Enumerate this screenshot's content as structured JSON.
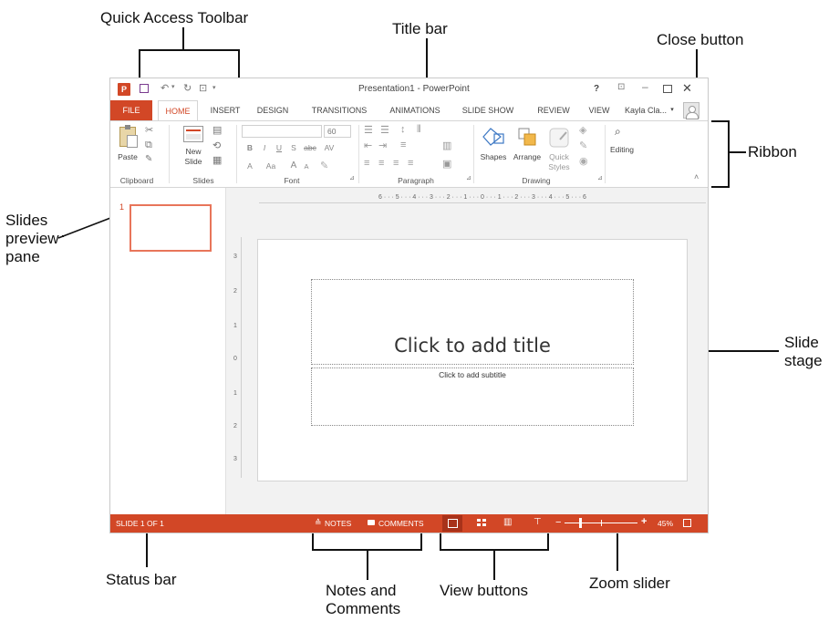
{
  "callouts": {
    "quick_access_toolbar": "Quick Access Toolbar",
    "title_bar": "Title bar",
    "close_button": "Close button",
    "ribbon": "Ribbon",
    "slides_preview_pane_1": "Slides",
    "slides_preview_pane_2": "preview",
    "slides_preview_pane_3": "pane",
    "slide_stage_1": "Slide",
    "slide_stage_2": "stage",
    "status_bar": "Status bar",
    "notes_comments_1": "Notes and",
    "notes_comments_2": "Comments",
    "view_buttons": "View buttons",
    "zoom_slider": "Zoom slider"
  },
  "window": {
    "title": "Presentation1 - PowerPoint",
    "help": "?",
    "user": "Kayla Cla...",
    "user_caret": "▾"
  },
  "tabs": [
    "FILE",
    "HOME",
    "INSERT",
    "DESIGN",
    "TRANSITIONS",
    "ANIMATIONS",
    "SLIDE SHOW",
    "REVIEW",
    "VIEW"
  ],
  "ribbon": {
    "paste": "Paste",
    "new_slide_1": "New",
    "new_slide_2": "Slide",
    "font_size": "60",
    "bold": "B",
    "italic": "I",
    "underline": "U",
    "shadow": "S",
    "strike": "abc",
    "spacing": "AV",
    "font_color": "A",
    "case": "Aa",
    "grow": "A",
    "shrink": "A",
    "shapes": "Shapes",
    "arrange": "Arrange",
    "quick_1": "Quick",
    "quick_2": "Styles",
    "editing": "Editing",
    "groups": {
      "clipboard": "Clipboard",
      "slides": "Slides",
      "font": "Font",
      "paragraph": "Paragraph",
      "drawing": "Drawing"
    }
  },
  "ruler": {
    "h": "6 · · · 5 · · · 4 · · · 3 · · · 2 · · · 1 · · · 0 · · · 1 · · · 2 · · · 3 · · · 4 · · · 5 · · · 6",
    "v": [
      "3",
      "2",
      "1",
      "0",
      "1",
      "2",
      "3"
    ]
  },
  "thumbnail": {
    "number": "1"
  },
  "slide": {
    "title_placeholder": "Click to add title",
    "subtitle_placeholder": "Click to add subtitle"
  },
  "status": {
    "slide_count": "SLIDE 1 OF 1",
    "notes": "NOTES",
    "comments": "COMMENTS",
    "zoom_minus": "−",
    "zoom_plus": "+",
    "zoom_pct": "45%"
  },
  "zoom_level": 0.45,
  "colors": {
    "accent": "#d24726",
    "ribbon_bg": "#ffffff",
    "stage_bg": "#f2f2f2"
  }
}
